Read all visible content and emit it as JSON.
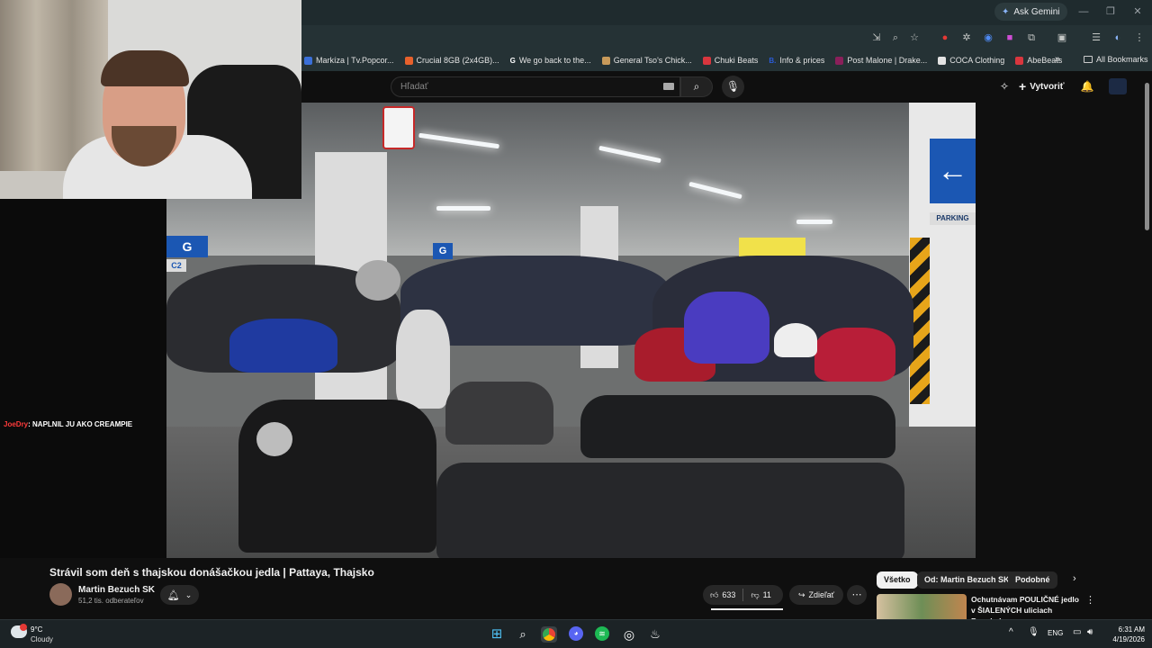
{
  "browser": {
    "ask_gemini": "Ask Gemini",
    "window_controls": [
      "minimize",
      "restore",
      "close"
    ]
  },
  "bookmarks": [
    {
      "label": "Markíza | Tv.Popcor...",
      "color": "#3a6fd8"
    },
    {
      "label": "Crucial 8GB (2x4GB)...",
      "color": "#e8612c"
    },
    {
      "label": "We go back to the...",
      "color": "#ffffff",
      "glyph": "G"
    },
    {
      "label": "General Tso's Chick...",
      "color": "#c89a5a"
    },
    {
      "label": "Chuki Beats",
      "color": "#d9363e"
    },
    {
      "label": "Info & prices",
      "color": "#2a5bd7",
      "glyph": "B."
    },
    {
      "label": "Post Malone | Drake...",
      "color": "#8a1f5a"
    },
    {
      "label": "COCA Clothing",
      "color": "#e3e3e3"
    },
    {
      "label": "AbeBeats",
      "color": "#d9363e"
    }
  ],
  "all_bookmarks": "All Bookmarks",
  "yt_header": {
    "search_placeholder": "Hľadať",
    "create_label": "Vytvoriť"
  },
  "chat": {
    "username": "JoeDry",
    "message": ": NAPLNIL JU AKO CREAMPIE"
  },
  "video_info": {
    "title": "Strávil som deň s thajskou donášačkou jedla | Pattaya, Thajsko",
    "channel_name": "Martin Bezuch SK",
    "subscribers": "51,2 tis. odberateľov",
    "likes": "633",
    "dislikes": "11",
    "share_label": "Zdieľať"
  },
  "video_overlay": {
    "sign_g": "G",
    "sign_c2": "C2",
    "parking_sign": "PARKING"
  },
  "chips": [
    {
      "label": "Všetko",
      "active": true
    },
    {
      "label": "Od: Martin Bezuch SK",
      "active": false
    },
    {
      "label": "Podobné",
      "active": false
    }
  ],
  "recommendation": {
    "title": "Ochutnávam POULIČNÉ jedlo v ŠIALENÝCH uliciach Bangkok..."
  },
  "taskbar": {
    "temperature": "9°C",
    "condition": "Cloudy",
    "language": "ENG",
    "time": "6:31 AM",
    "date": "4/19/2026"
  }
}
